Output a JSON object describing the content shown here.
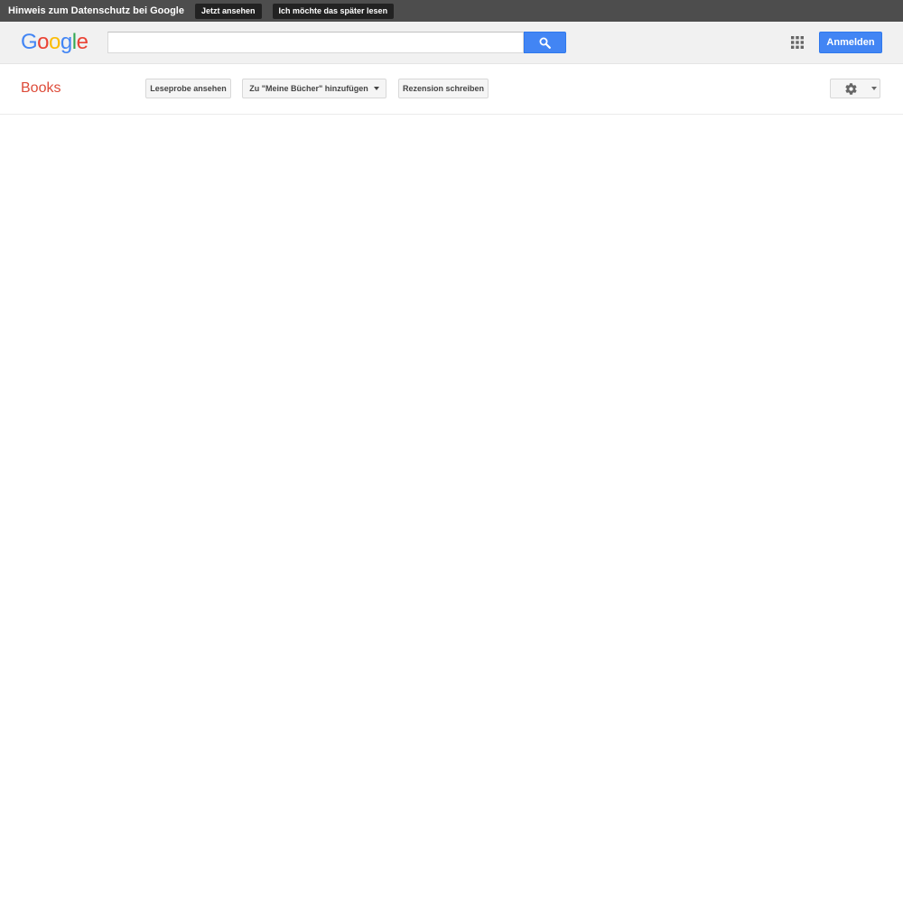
{
  "privacy_bar": {
    "text": "Hinweis zum Datenschutz bei Google",
    "view_now_label": "Jetzt ansehen",
    "read_later_label": "Ich möchte das später lesen"
  },
  "header": {
    "logo_letters": [
      {
        "char": "G",
        "color": "#4285f4"
      },
      {
        "char": "o",
        "color": "#ea4335"
      },
      {
        "char": "o",
        "color": "#fbbc05"
      },
      {
        "char": "g",
        "color": "#4285f4"
      },
      {
        "char": "l",
        "color": "#34a853"
      },
      {
        "char": "e",
        "color": "#ea4335"
      }
    ],
    "search": {
      "value": "",
      "placeholder": ""
    },
    "search_icon": "search-icon",
    "apps_icon": "apps-grid-icon",
    "signin_label": "Anmelden"
  },
  "books_bar": {
    "title": "Books",
    "preview_label": "Leseprobe ansehen",
    "add_to_library_label": "Zu \"Meine Bücher\" hinzufügen",
    "write_review_label": "Rezension schreiben",
    "settings_icon": "gear-icon"
  },
  "colors": {
    "privacy_bar_bg": "#4d4d4d",
    "header_bg": "#f1f1f1",
    "accent_blue": "#4285f4",
    "books_red": "#dd4b39"
  }
}
